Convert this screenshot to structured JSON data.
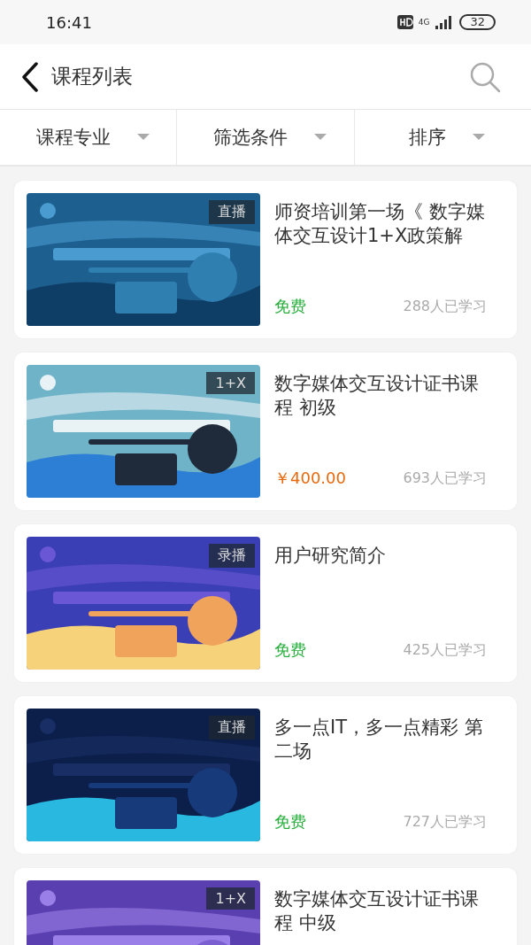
{
  "status_bar": {
    "time": "16:41",
    "network": "4G",
    "battery": "32"
  },
  "header": {
    "title": "课程列表"
  },
  "filters": [
    {
      "label": "课程专业"
    },
    {
      "label": "筛选条件"
    },
    {
      "label": "排序"
    }
  ],
  "courses": [
    {
      "badge": "直播",
      "title": "师资培训第一场《 数字媒体交互设计1+X政策解",
      "price": "免费",
      "kind": "free",
      "learners": "288人已学习"
    },
    {
      "badge": "1+X",
      "title": "数字媒体交互设计证书课程 初级",
      "price": "￥400.00",
      "kind": "paid",
      "learners": "693人已学习"
    },
    {
      "badge": "录播",
      "title": "用户研究简介",
      "price": "免费",
      "kind": "free",
      "learners": "425人已学习"
    },
    {
      "badge": "直播",
      "title": "多一点IT，多一点精彩 第二场",
      "price": "免费",
      "kind": "free",
      "learners": "727人已学习"
    },
    {
      "badge": "1+X",
      "title": "数字媒体交互设计证书课程 中级"
    }
  ]
}
